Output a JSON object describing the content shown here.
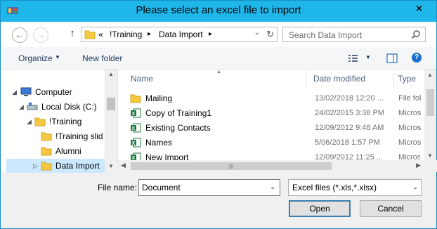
{
  "window": {
    "title": "Please select an excel file to import",
    "close_glyph": "✕"
  },
  "nav": {
    "back_glyph": "←",
    "forward_glyph": "→",
    "up_glyph": "↑",
    "breadcrumb": [
      {
        "label": "«",
        "arrow": ""
      },
      {
        "label": "!Training",
        "arrow": "▸"
      },
      {
        "label": "Data Import",
        "arrow": "▸"
      }
    ],
    "refresh_glyph": "↻",
    "dropdown_glyph": "⌄",
    "search_placeholder": "Search Data Import"
  },
  "toolbar": {
    "organize_label": "Organize",
    "new_folder_label": "New folder",
    "arrow_glyph": "▼"
  },
  "tree": {
    "items": [
      {
        "label": "Computer",
        "icon": "computer-icon"
      },
      {
        "label": "Local Disk (C:)",
        "icon": "drive-icon"
      },
      {
        "label": "!Training",
        "icon": "folder-icon"
      },
      {
        "label": "!Training slid",
        "icon": "folder-icon"
      },
      {
        "label": "Alumni",
        "icon": "folder-icon"
      },
      {
        "label": "Data Import",
        "icon": "folder-icon",
        "selected": true
      }
    ],
    "expand_glyph": "◢",
    "collapsed_glyph": "▷"
  },
  "files": {
    "columns": [
      "Name",
      "Date modified",
      "Type"
    ],
    "rows": [
      {
        "name": "Mailing",
        "date": "13/02/2018 12:20 ...",
        "type": "File fol",
        "icon": "folder-icon"
      },
      {
        "name": "Copy of Training1",
        "date": "24/02/2015 3:38 PM",
        "type": "Micros",
        "icon": "excel-icon"
      },
      {
        "name": "Existing Contacts",
        "date": "12/09/2012 9:48 AM",
        "type": "Micros",
        "icon": "excel-icon"
      },
      {
        "name": "Names",
        "date": "5/06/2018 1:57 PM",
        "type": "Micros",
        "icon": "excel-icon"
      },
      {
        "name": "New Import",
        "date": "12/09/2012 11:25 ...",
        "type": "Micros",
        "icon": "excel-icon"
      }
    ]
  },
  "footer": {
    "file_name_label": "File name:",
    "file_name_value": "Document",
    "filter_value": "Excel files (*.xls,*.xlsx)",
    "open_label": "Open",
    "cancel_label": "Cancel"
  },
  "colors": {
    "titlebar": "#1fb7ea",
    "selection": "#cce8ff",
    "excel_green": "#1d7a3e",
    "folder_yellow": "#f5c842"
  }
}
